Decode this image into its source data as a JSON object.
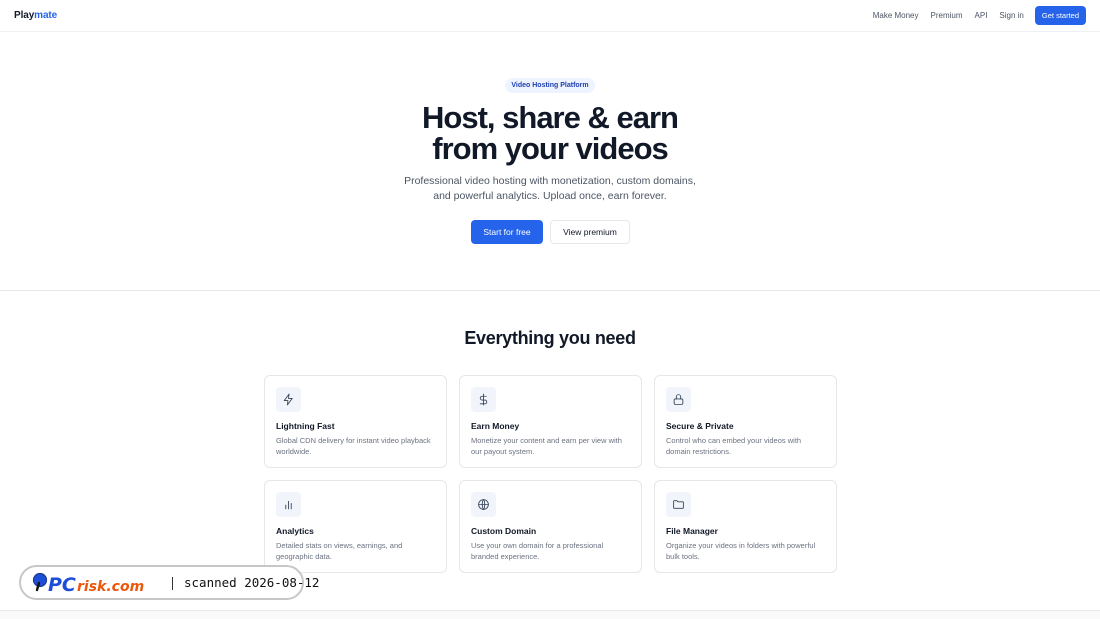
{
  "header": {
    "logo_part1": "Play",
    "logo_part2": "mate",
    "nav": [
      {
        "label": "Make Money"
      },
      {
        "label": "Premium"
      },
      {
        "label": "API"
      },
      {
        "label": "Sign in"
      }
    ],
    "cta_label": "Get started"
  },
  "hero": {
    "badge": "Video Hosting Platform",
    "headline_line1": "Host, share & earn",
    "headline_line2": "from your videos",
    "subtitle": "Professional video hosting with monetization, custom domains, and powerful analytics. Upload once, earn forever.",
    "primary_label": "Start for free",
    "secondary_label": "View premium"
  },
  "features": {
    "title": "Everything you need",
    "cards": [
      {
        "icon": "lightning-icon",
        "title": "Lightning Fast",
        "desc": "Global CDN delivery for instant video playback worldwide."
      },
      {
        "icon": "dollar-icon",
        "title": "Earn Money",
        "desc": "Monetize your content and earn per view with our payout system."
      },
      {
        "icon": "lock-icon",
        "title": "Secure & Private",
        "desc": "Control who can embed your videos with domain restrictions."
      },
      {
        "icon": "bar-chart-icon",
        "title": "Analytics",
        "desc": "Detailed stats on views, earnings, and geographic data."
      },
      {
        "icon": "globe-icon",
        "title": "Custom Domain",
        "desc": "Use your own domain for a professional branded experience."
      },
      {
        "icon": "folder-icon",
        "title": "File Manager",
        "desc": "Organize your videos in folders with powerful bulk tools."
      }
    ]
  },
  "watermark": {
    "brand": "PCrisk.com",
    "scan_text": "scanned 2026-08-12"
  },
  "colors": {
    "accent": "#2563eb",
    "badge_bg": "#eef4ff",
    "border": "#e5e7eb"
  }
}
